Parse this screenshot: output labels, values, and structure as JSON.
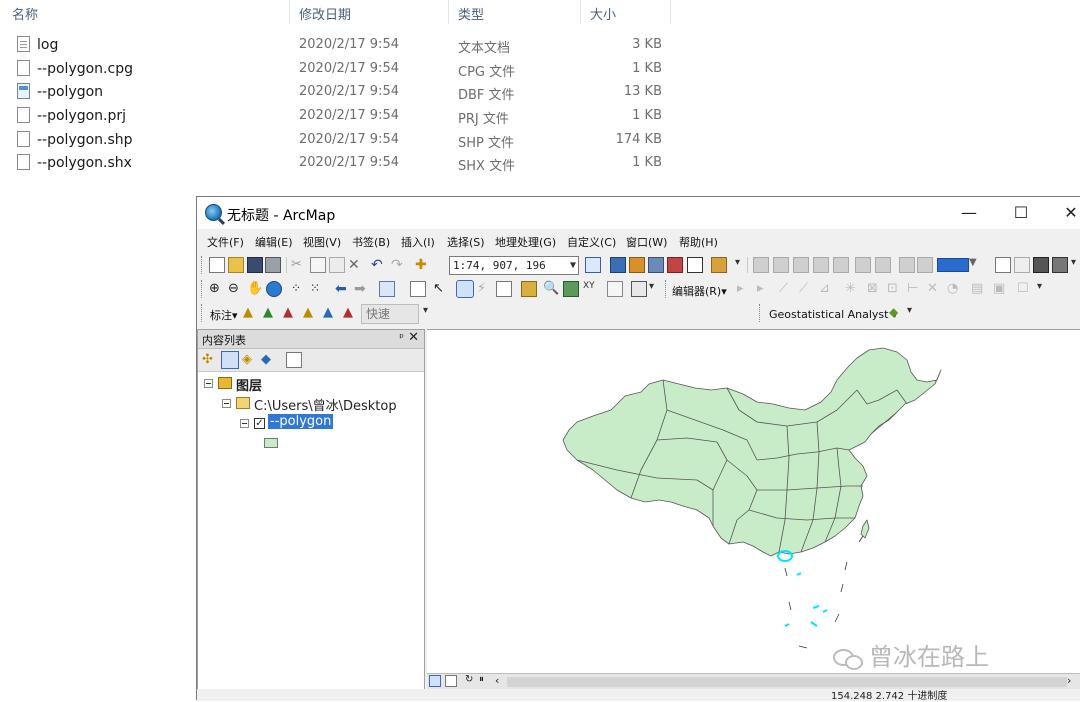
{
  "explorer": {
    "columns": {
      "name": "名称",
      "date": "修改日期",
      "type": "类型",
      "size": "大小"
    },
    "files": [
      {
        "name": "log",
        "date": "2020/2/17 9:54",
        "type": "文本文档",
        "size": "3 KB",
        "icon": "text-file-icon"
      },
      {
        "name": "--polygon.cpg",
        "date": "2020/2/17 9:54",
        "type": "CPG 文件",
        "size": "1 KB",
        "icon": "file-icon"
      },
      {
        "name": "--polygon",
        "date": "2020/2/17 9:54",
        "type": "DBF 文件",
        "size": "13 KB",
        "icon": "dbf-file-icon"
      },
      {
        "name": "--polygon.prj",
        "date": "2020/2/17 9:54",
        "type": "PRJ 文件",
        "size": "1 KB",
        "icon": "file-icon"
      },
      {
        "name": "--polygon.shp",
        "date": "2020/2/17 9:54",
        "type": "SHP 文件",
        "size": "174 KB",
        "icon": "file-icon"
      },
      {
        "name": "--polygon.shx",
        "date": "2020/2/17 9:54",
        "type": "SHX 文件",
        "size": "1 KB",
        "icon": "file-icon"
      }
    ]
  },
  "arcmap": {
    "title": "无标题 - ArcMap",
    "window_controls": {
      "minimize": "—",
      "maximize": "☐",
      "close": "✕"
    },
    "menu": [
      "文件(F)",
      "编辑(E)",
      "视图(V)",
      "书签(B)",
      "插入(I)",
      "选择(S)",
      "地理处理(G)",
      "自定义(C)",
      "窗口(W)",
      "帮助(H)"
    ],
    "scale": "1:74, 907, 196",
    "editor_label": "编辑器(R)▾",
    "label_menu": "标注▾",
    "quick_label": "快速",
    "geostat_label": "Geostatistical Analyst ▾",
    "toc": {
      "title": "内容列表",
      "pin": "ᵖ",
      "close": "✕",
      "root": "图层",
      "folder": "C:\\Users\\曾冰\\Desktop",
      "layer": "--polygon"
    },
    "status_coords": "154.248   2.742 十进制度",
    "watermark": "曾冰在路上",
    "colors": {
      "fill": "#c8ecc8",
      "outline": "#555555",
      "selection": "#00e5ff",
      "highlight": "#3178d6"
    }
  }
}
